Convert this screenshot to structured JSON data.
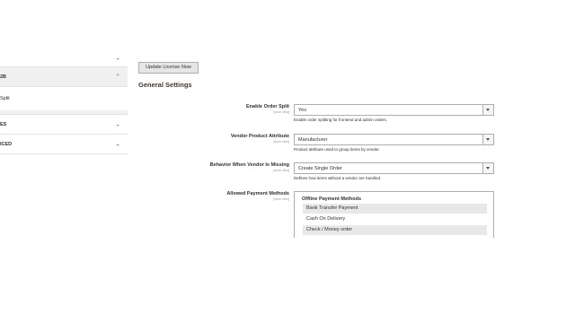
{
  "sidebar": {
    "items": [
      {
        "label": ""
      },
      {
        "label": "2B"
      },
      {
        "label": "Split"
      },
      {
        "label": "ES"
      },
      {
        "label": "ICED"
      }
    ]
  },
  "main": {
    "update_button": "Update License Now",
    "section_title": "General Settings",
    "fields": {
      "order_split": {
        "label": "Enable Order Split",
        "scope": "[store view]",
        "value": "Yes",
        "note": "Enable order splitting for frontend and admin orders."
      },
      "vendor_attr": {
        "label": "Vendor Product Attribute",
        "scope": "[store view]",
        "value": "Manufacturer",
        "note": "Product attribute used to group items by vendor."
      },
      "missing_vendor": {
        "label": "Behavior When Vendor Is Missing",
        "scope": "[store view]",
        "value": "Create Single Order",
        "note": "Defines how items without a vendor are handled."
      },
      "payment_methods": {
        "label": "Allowed Payment Methods",
        "scope": "[store view]",
        "group": "Offline Payment Methods",
        "options": [
          "Bank Transfer Payment",
          "Cash On Delivery",
          "Check / Money order"
        ]
      }
    }
  }
}
